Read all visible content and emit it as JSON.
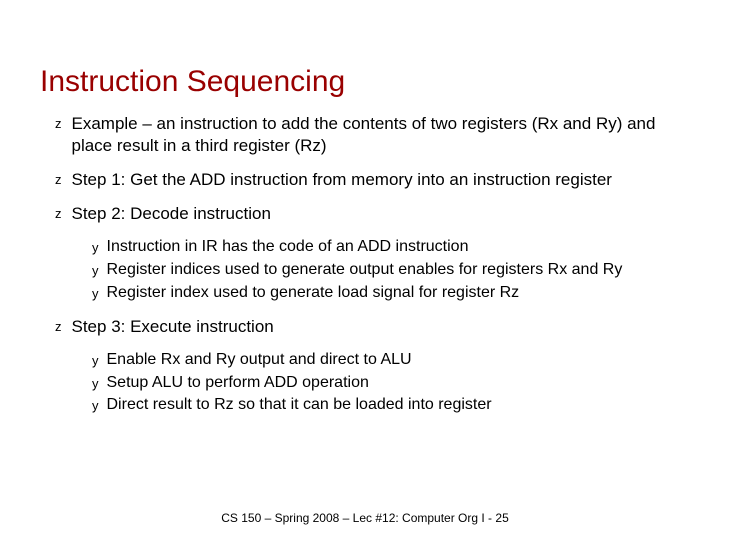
{
  "title": "Instruction Sequencing",
  "bullets": {
    "b0": {
      "glyph": "z",
      "text": "Example – an instruction to add the contents of two registers (Rx and Ry) and place result in a third register (Rz)"
    },
    "b1": {
      "glyph": "z",
      "text": "Step 1: Get the ADD instruction from memory into an instruction register"
    },
    "b2": {
      "glyph": "z",
      "text": "Step 2: Decode instruction",
      "subs": {
        "s0": {
          "glyph": "y",
          "text": "Instruction in IR has the code of an ADD instruction"
        },
        "s1": {
          "glyph": "y",
          "text": "Register indices used to generate output enables for registers Rx and Ry"
        },
        "s2": {
          "glyph": "y",
          "text": "Register index used to generate load signal for register Rz"
        }
      }
    },
    "b3": {
      "glyph": "z",
      "text": "Step 3: Execute instruction",
      "subs": {
        "s0": {
          "glyph": "y",
          "text": "Enable Rx and Ry output and direct to ALU"
        },
        "s1": {
          "glyph": "y",
          "text": "Setup ALU to perform ADD operation"
        },
        "s2": {
          "glyph": "y",
          "text": "Direct result to Rz so that it can be loaded into register"
        }
      }
    }
  },
  "footer": "CS 150 – Spring  2008 – Lec #12: Computer Org I -  25"
}
